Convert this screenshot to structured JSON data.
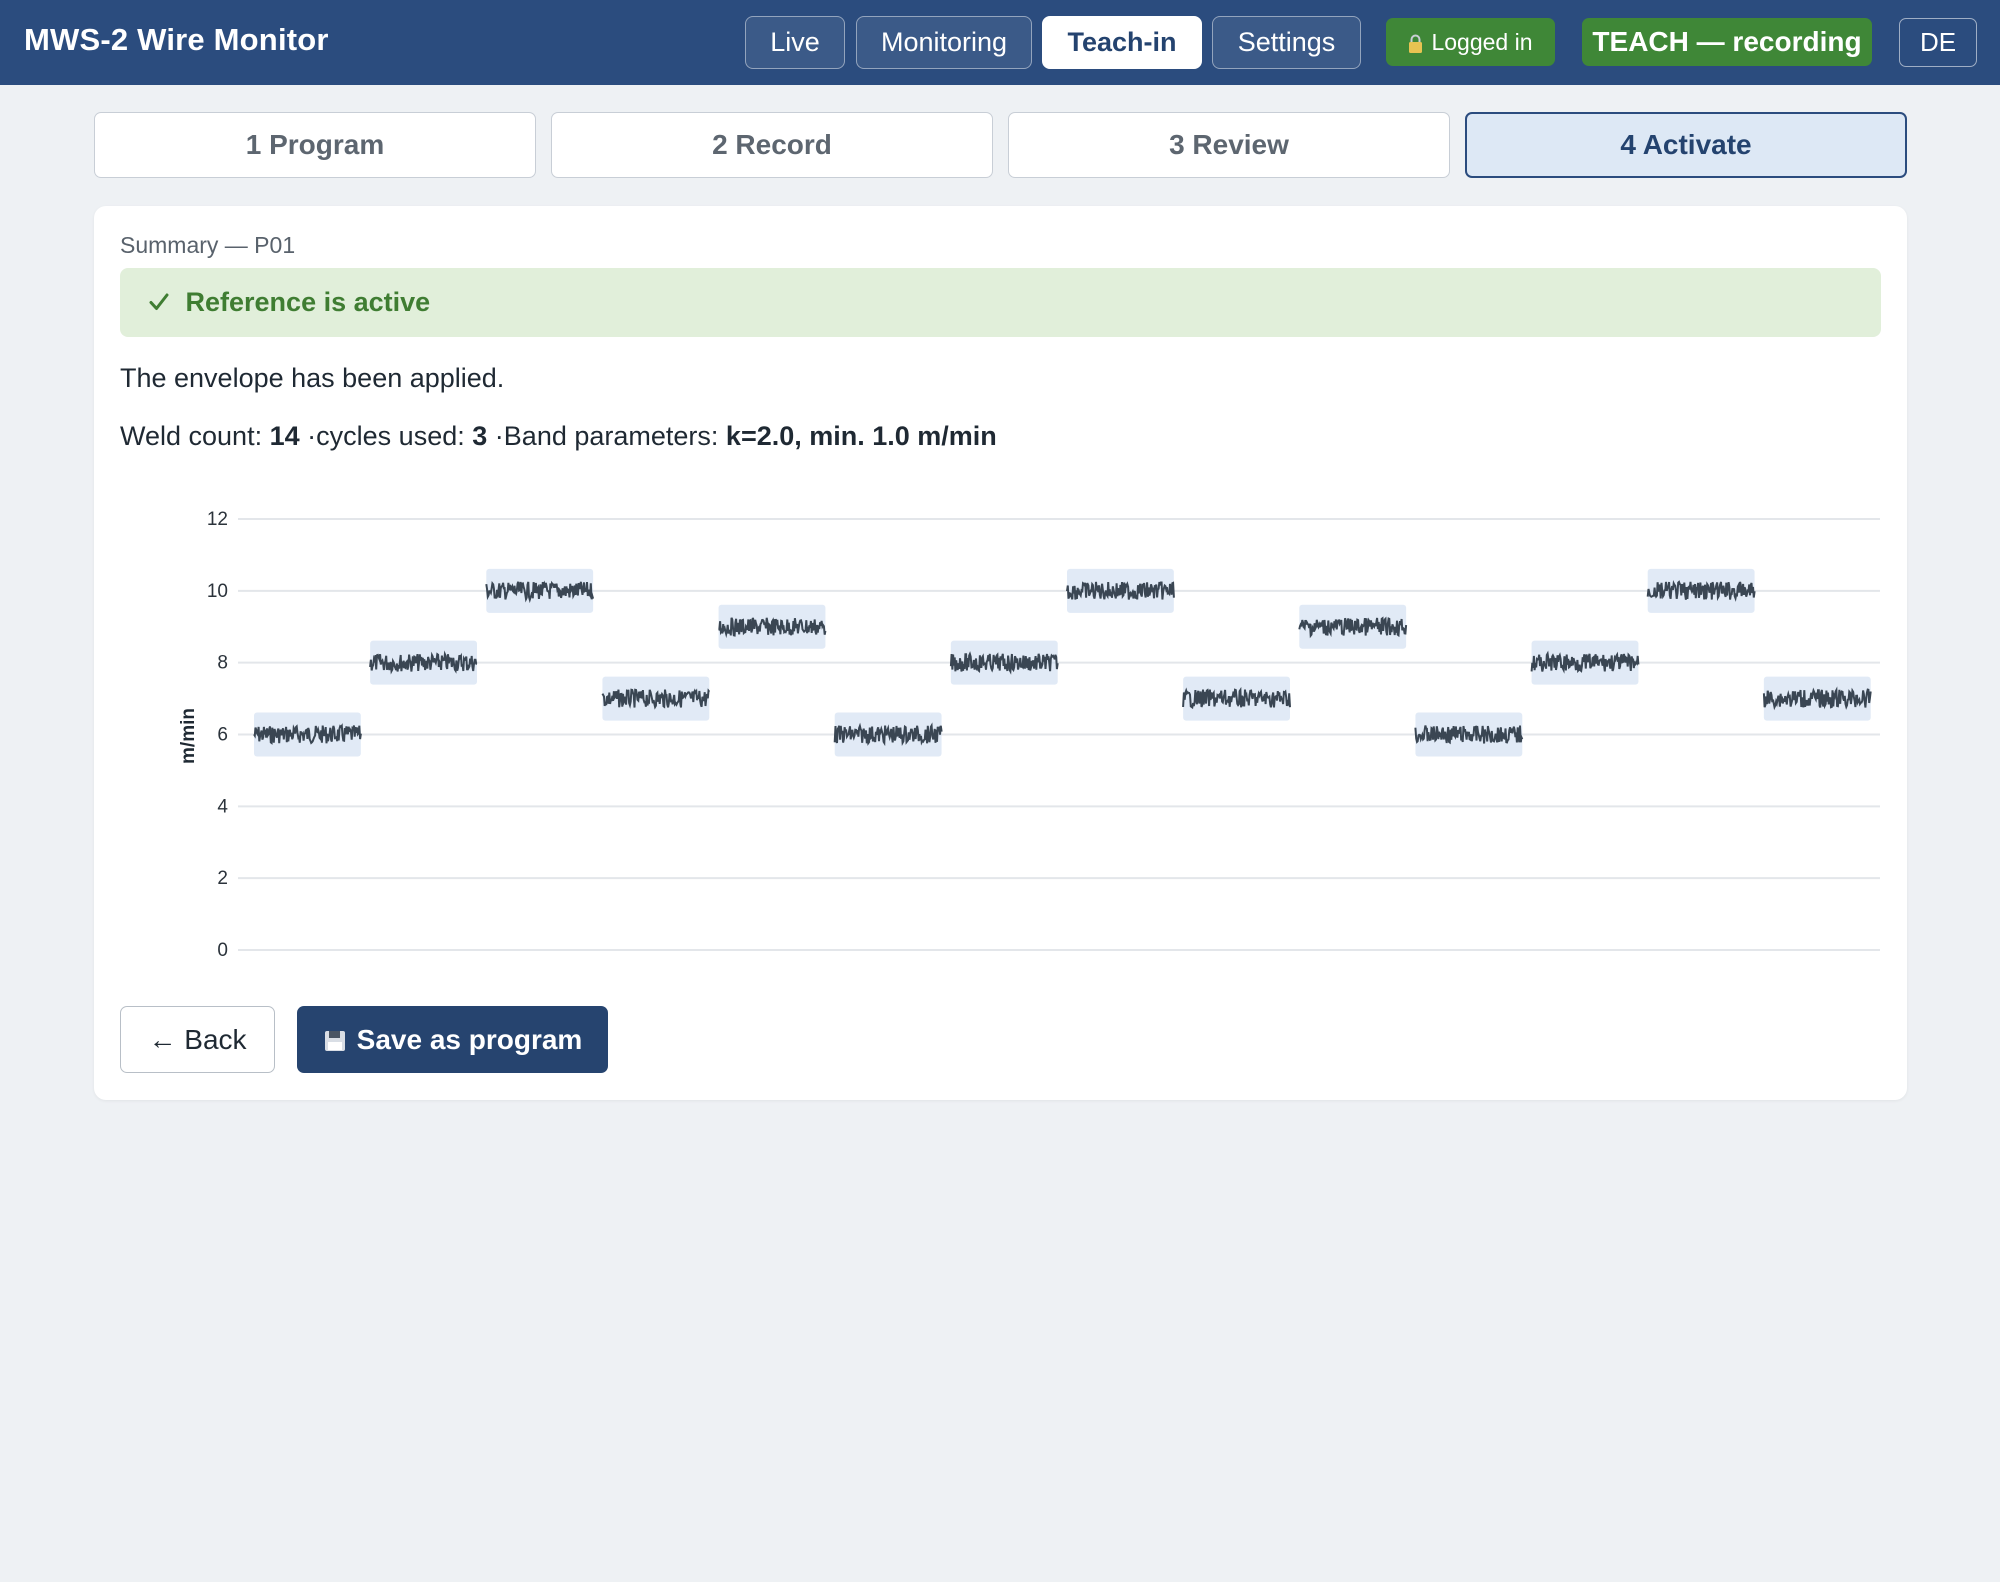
{
  "header": {
    "title": "MWS-2 Wire Monitor",
    "tabs": [
      {
        "label": "Live",
        "active": false
      },
      {
        "label": "Monitoring",
        "active": false
      },
      {
        "label": "Teach-in",
        "active": true
      },
      {
        "label": "Settings",
        "active": false
      }
    ],
    "login_status": "Logged in",
    "login_icon": "lock-icon",
    "mode_badge": "TEACH — recording",
    "language": "DE",
    "colors": {
      "header_bg": "#2b4c7e",
      "badge_green": "#3f8737"
    }
  },
  "steps": [
    {
      "label": "1 Program",
      "current": false
    },
    {
      "label": "2 Record",
      "current": false
    },
    {
      "label": "3 Review",
      "current": false
    },
    {
      "label": "4 Activate",
      "current": true
    }
  ],
  "summary": {
    "label": "Summary — P01",
    "status_icon": "check-icon",
    "status_text": "Reference is active",
    "message": "The envelope has been applied.",
    "stats": {
      "weld_count_label": "Weld count:",
      "weld_count": "14",
      "cycles_label": "·cycles used:",
      "cycles": "3",
      "band_label": "·Band parameters:",
      "band_value": "k=2.0, min. 1.0 m/min"
    }
  },
  "chart_data": {
    "type": "line",
    "ylabel": "m/min",
    "ylim": [
      0,
      12
    ],
    "yticks": [
      "0",
      "2",
      "4",
      "6",
      "8",
      "10",
      "12"
    ],
    "grid": true,
    "segments": [
      {
        "index": 1,
        "value": 6
      },
      {
        "index": 2,
        "value": 8
      },
      {
        "index": 3,
        "value": 10
      },
      {
        "index": 4,
        "value": 7
      },
      {
        "index": 5,
        "value": 9
      },
      {
        "index": 6,
        "value": 6
      },
      {
        "index": 7,
        "value": 8
      },
      {
        "index": 8,
        "value": 10
      },
      {
        "index": 9,
        "value": 7
      },
      {
        "index": 10,
        "value": 9
      },
      {
        "index": 11,
        "value": 6
      },
      {
        "index": 12,
        "value": 8
      },
      {
        "index": 13,
        "value": 10
      },
      {
        "index": 14,
        "value": 7
      }
    ],
    "colors": {
      "signal": "#3a4653",
      "band": "#c9d9ee"
    }
  },
  "actions": {
    "back_label": "← Back",
    "save_label": "Save as program",
    "save_icon": "disk-icon"
  }
}
